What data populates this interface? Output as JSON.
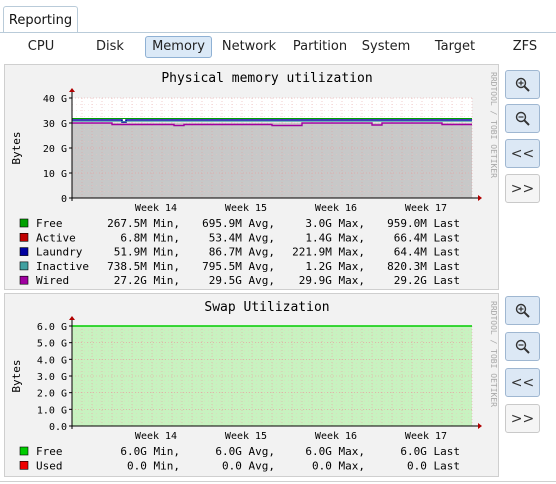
{
  "top_tab": {
    "label": "Reporting"
  },
  "tabs": [
    {
      "label": "CPU",
      "active": false
    },
    {
      "label": "Disk",
      "active": false
    },
    {
      "label": "Memory",
      "active": true
    },
    {
      "label": "Network",
      "active": false
    },
    {
      "label": "Partition",
      "active": false
    },
    {
      "label": "System",
      "active": false
    },
    {
      "label": "Target",
      "active": false
    },
    {
      "label": "ZFS",
      "active": false
    }
  ],
  "side_buttons": {
    "zoom_in": "+",
    "zoom_out": "−",
    "back": "<<",
    "forward": ">>"
  },
  "watermark": "RRDTOOL / TOBI OETIKER",
  "colors": {
    "free": "#00a000",
    "active": "#c00000",
    "laundry": "#0000a0",
    "inactive": "#40a0a0",
    "wired": "#a000a0",
    "swap_free": "#00cc00",
    "swap_used": "#ee0000",
    "mem_fill": "#c8c8c8",
    "swap_fill": "#c8f2c0"
  },
  "chart_data": [
    {
      "type": "area",
      "title": "Physical memory utilization",
      "ylabel": "Bytes",
      "yticks": [
        "0",
        "10 G",
        "20 G",
        "30 G",
        "40 G"
      ],
      "ylim": [
        0,
        40
      ],
      "xticks": [
        "Week 14",
        "Week 15",
        "Week 16",
        "Week 17"
      ],
      "series": [
        {
          "name": "Free",
          "color_key": "free",
          "stats": [
            "267.5M Min,",
            "695.9M Avg,",
            "3.0G Max,",
            "959.0M Last"
          ]
        },
        {
          "name": "Active",
          "color_key": "active",
          "stats": [
            "6.8M Min,",
            "53.4M Avg,",
            "1.4G Max,",
            "66.4M Last"
          ]
        },
        {
          "name": "Laundry",
          "color_key": "laundry",
          "stats": [
            "51.9M Min,",
            "86.7M Avg,",
            "221.9M Max,",
            "64.4M Last"
          ]
        },
        {
          "name": "Inactive",
          "color_key": "inactive",
          "stats": [
            "738.5M Min,",
            "795.5M Avg,",
            "1.2G Max,",
            "820.3M Last"
          ]
        },
        {
          "name": "Wired",
          "color_key": "wired",
          "stats": [
            "27.2G Min,",
            "29.5G Avg,",
            "29.9G Max,",
            "29.2G Last"
          ]
        }
      ]
    },
    {
      "type": "area",
      "title": "Swap Utilization",
      "ylabel": "Bytes",
      "yticks": [
        "0.0",
        "1.0 G",
        "2.0 G",
        "3.0 G",
        "4.0 G",
        "5.0 G",
        "6.0 G"
      ],
      "ylim": [
        0,
        6
      ],
      "xticks": [
        "Week 14",
        "Week 15",
        "Week 16",
        "Week 17"
      ],
      "series": [
        {
          "name": "Free",
          "color_key": "swap_free",
          "stats": [
            "6.0G Min,",
            "6.0G Avg,",
            "6.0G Max,",
            "6.0G Last"
          ]
        },
        {
          "name": "Used",
          "color_key": "swap_used",
          "stats": [
            "0.0 Min,",
            "0.0 Avg,",
            "0.0 Max,",
            "0.0 Last"
          ]
        }
      ]
    }
  ]
}
